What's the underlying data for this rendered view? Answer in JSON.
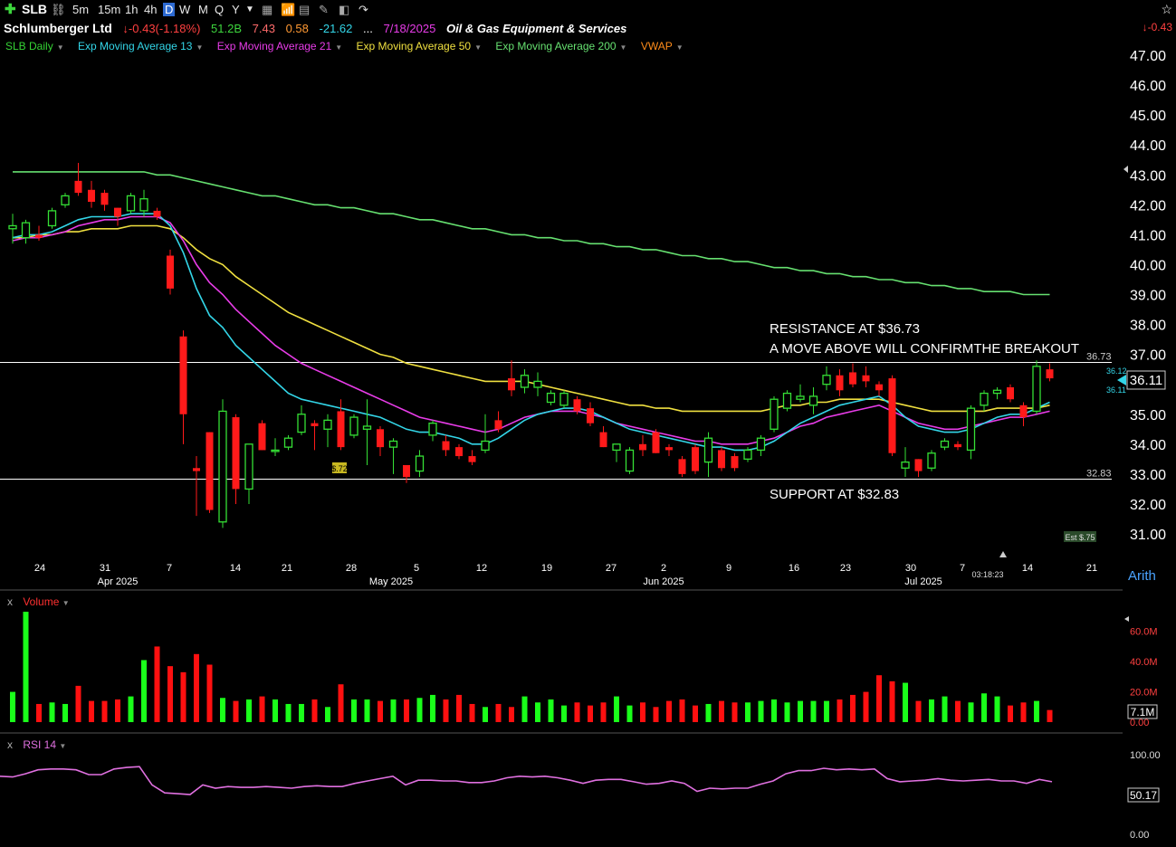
{
  "toolbar": {
    "symbol": "SLB",
    "intervals": [
      "5m",
      "15m",
      "1h",
      "4h",
      "D",
      "W",
      "M",
      "Q",
      "Y"
    ],
    "selected_interval": "D"
  },
  "header": {
    "company": "Schlumberger Ltd",
    "change": "-0.43(-1.18%)",
    "volume": "51.2B",
    "v1": "7.43",
    "v2": "0.58",
    "v3": "-21.62",
    "dots": "...",
    "date": "7/18/2025",
    "industry": "Oil & Gas Equipment & Services",
    "right_change": "-0.43"
  },
  "legend": [
    {
      "label": "SLB Daily",
      "color": "#35d435"
    },
    {
      "label": "Exp Moving Average 13",
      "color": "#33d6e8"
    },
    {
      "label": "Exp Moving Average 21",
      "color": "#e83ce8"
    },
    {
      "label": "Exp Moving Average 50",
      "color": "#f0e040"
    },
    {
      "label": "Exp Moving Average 200",
      "color": "#66e070"
    },
    {
      "label": "VWAP",
      "color": "#ff8c1a"
    }
  ],
  "annotations": {
    "resistance_line1": "RESISTANCE AT $36.73",
    "resistance_line2": "A MOVE ABOVE WILL CONFIRMTHE BREAKOUT",
    "support": "SUPPORT AT $32.83",
    "resistance_value": "36.73",
    "support_value": "32.83",
    "ema13_tag": "36.12",
    "ema_tag2": "36.11",
    "last_price": "36.11",
    "low_label": "$.72",
    "est_label": "Est $.75",
    "timer": "03:18:23",
    "scale_mode": "Arith"
  },
  "volume_pane": {
    "title": "Volume",
    "ticks": [
      "60.0M",
      "40.0M",
      "20.0M",
      "0.00"
    ],
    "last": "7.1M"
  },
  "rsi_pane": {
    "title": "RSI 14",
    "ticks": [
      "100.00",
      "0.00"
    ],
    "last": "50.17"
  },
  "chart_data": {
    "type": "candlestick",
    "y_axis": {
      "ticks": [
        "47.00",
        "46.00",
        "45.00",
        "44.00",
        "43.00",
        "42.00",
        "41.00",
        "40.00",
        "39.00",
        "38.00",
        "37.00",
        "36.00",
        "35.00",
        "34.00",
        "33.00",
        "32.00",
        "31.00"
      ],
      "range": [
        30.5,
        47.8
      ]
    },
    "x_axis": {
      "day_ticks": [
        "24",
        "31",
        "7",
        "14",
        "21",
        "28",
        "5",
        "12",
        "19",
        "27",
        "2",
        "9",
        "16",
        "23",
        "30",
        "7",
        "14",
        "21"
      ],
      "month_ticks": [
        "Apr 2025",
        "May 2025",
        "Jun 2025",
        "Jul 2025"
      ]
    },
    "candles": [
      {
        "o": 41.2,
        "h": 41.7,
        "l": 40.7,
        "c": 41.3
      },
      {
        "o": 40.9,
        "h": 41.5,
        "l": 40.7,
        "c": 41.4
      },
      {
        "o": 41.0,
        "h": 41.3,
        "l": 40.8,
        "c": 40.9
      },
      {
        "o": 41.3,
        "h": 41.9,
        "l": 41.2,
        "c": 41.8
      },
      {
        "o": 42.0,
        "h": 42.4,
        "l": 41.9,
        "c": 42.3
      },
      {
        "o": 42.8,
        "h": 43.4,
        "l": 42.3,
        "c": 42.4
      },
      {
        "o": 42.5,
        "h": 42.8,
        "l": 41.9,
        "c": 42.1
      },
      {
        "o": 42.4,
        "h": 42.5,
        "l": 41.8,
        "c": 42.0
      },
      {
        "o": 41.9,
        "h": 41.9,
        "l": 41.3,
        "c": 41.6
      },
      {
        "o": 41.8,
        "h": 42.4,
        "l": 41.7,
        "c": 42.3
      },
      {
        "o": 41.8,
        "h": 42.5,
        "l": 41.6,
        "c": 42.2
      },
      {
        "o": 41.8,
        "h": 41.9,
        "l": 41.5,
        "c": 41.6
      },
      {
        "o": 40.3,
        "h": 40.5,
        "l": 39.0,
        "c": 39.2
      },
      {
        "o": 37.6,
        "h": 37.8,
        "l": 34.0,
        "c": 35.0
      },
      {
        "o": 33.2,
        "h": 33.6,
        "l": 31.6,
        "c": 33.1
      },
      {
        "o": 34.4,
        "h": 34.4,
        "l": 31.7,
        "c": 31.8
      },
      {
        "o": 31.4,
        "h": 35.5,
        "l": 31.2,
        "c": 35.1
      },
      {
        "o": 34.9,
        "h": 35.0,
        "l": 32.0,
        "c": 32.5
      },
      {
        "o": 32.5,
        "h": 34.0,
        "l": 32.0,
        "c": 34.0
      },
      {
        "o": 34.7,
        "h": 34.8,
        "l": 33.8,
        "c": 33.8
      },
      {
        "o": 33.8,
        "h": 34.2,
        "l": 33.6,
        "c": 33.8
      },
      {
        "o": 33.9,
        "h": 34.3,
        "l": 33.8,
        "c": 34.2
      },
      {
        "o": 34.4,
        "h": 35.3,
        "l": 34.3,
        "c": 35.0
      },
      {
        "o": 34.7,
        "h": 34.8,
        "l": 33.8,
        "c": 34.6
      },
      {
        "o": 34.5,
        "h": 35.0,
        "l": 33.9,
        "c": 34.8
      },
      {
        "o": 35.1,
        "h": 35.5,
        "l": 33.8,
        "c": 33.9
      },
      {
        "o": 34.3,
        "h": 35.0,
        "l": 34.2,
        "c": 34.9
      },
      {
        "o": 34.5,
        "h": 35.5,
        "l": 33.3,
        "c": 34.6
      },
      {
        "o": 34.5,
        "h": 34.6,
        "l": 33.6,
        "c": 33.9
      },
      {
        "o": 33.9,
        "h": 34.2,
        "l": 33.0,
        "c": 34.1
      },
      {
        "o": 33.3,
        "h": 33.3,
        "l": 32.7,
        "c": 32.9
      },
      {
        "o": 33.1,
        "h": 33.8,
        "l": 32.9,
        "c": 33.6
      },
      {
        "o": 34.3,
        "h": 34.8,
        "l": 34.1,
        "c": 34.7
      },
      {
        "o": 34.1,
        "h": 34.3,
        "l": 33.6,
        "c": 33.8
      },
      {
        "o": 33.9,
        "h": 34.0,
        "l": 33.5,
        "c": 33.6
      },
      {
        "o": 33.6,
        "h": 33.8,
        "l": 33.3,
        "c": 33.4
      },
      {
        "o": 33.8,
        "h": 35.0,
        "l": 33.7,
        "c": 34.1
      },
      {
        "o": 34.8,
        "h": 35.1,
        "l": 34.4,
        "c": 34.5
      },
      {
        "o": 36.2,
        "h": 36.8,
        "l": 35.6,
        "c": 35.8
      },
      {
        "o": 35.9,
        "h": 36.5,
        "l": 35.7,
        "c": 36.3
      },
      {
        "o": 35.9,
        "h": 36.4,
        "l": 35.6,
        "c": 36.1
      },
      {
        "o": 35.4,
        "h": 35.8,
        "l": 35.3,
        "c": 35.7
      },
      {
        "o": 35.3,
        "h": 35.8,
        "l": 35.2,
        "c": 35.7
      },
      {
        "o": 35.5,
        "h": 35.6,
        "l": 35.0,
        "c": 35.1
      },
      {
        "o": 35.2,
        "h": 35.4,
        "l": 34.6,
        "c": 34.7
      },
      {
        "o": 34.4,
        "h": 34.6,
        "l": 33.9,
        "c": 33.9
      },
      {
        "o": 33.8,
        "h": 34.0,
        "l": 33.4,
        "c": 34.0
      },
      {
        "o": 33.1,
        "h": 33.9,
        "l": 33.0,
        "c": 33.8
      },
      {
        "o": 34.0,
        "h": 34.3,
        "l": 33.6,
        "c": 33.8
      },
      {
        "o": 34.4,
        "h": 34.5,
        "l": 33.7,
        "c": 33.7
      },
      {
        "o": 33.9,
        "h": 34.0,
        "l": 33.6,
        "c": 33.8
      },
      {
        "o": 33.5,
        "h": 33.6,
        "l": 32.9,
        "c": 33.0
      },
      {
        "o": 33.9,
        "h": 34.0,
        "l": 33.0,
        "c": 33.1
      },
      {
        "o": 33.4,
        "h": 34.4,
        "l": 32.9,
        "c": 34.2
      },
      {
        "o": 33.8,
        "h": 33.9,
        "l": 33.1,
        "c": 33.2
      },
      {
        "o": 33.6,
        "h": 33.7,
        "l": 33.1,
        "c": 33.2
      },
      {
        "o": 33.5,
        "h": 33.9,
        "l": 33.4,
        "c": 33.8
      },
      {
        "o": 33.8,
        "h": 34.3,
        "l": 33.6,
        "c": 34.2
      },
      {
        "o": 34.5,
        "h": 35.6,
        "l": 34.4,
        "c": 35.5
      },
      {
        "o": 35.2,
        "h": 35.8,
        "l": 35.1,
        "c": 35.7
      },
      {
        "o": 35.5,
        "h": 36.0,
        "l": 35.4,
        "c": 35.6
      },
      {
        "o": 35.3,
        "h": 35.9,
        "l": 35.0,
        "c": 35.6
      },
      {
        "o": 36.0,
        "h": 36.6,
        "l": 35.8,
        "c": 36.3
      },
      {
        "o": 36.3,
        "h": 36.5,
        "l": 35.6,
        "c": 35.8
      },
      {
        "o": 36.4,
        "h": 36.7,
        "l": 35.9,
        "c": 36.0
      },
      {
        "o": 36.3,
        "h": 36.6,
        "l": 35.9,
        "c": 36.1
      },
      {
        "o": 36.0,
        "h": 36.1,
        "l": 35.6,
        "c": 35.8
      },
      {
        "o": 36.2,
        "h": 36.3,
        "l": 33.6,
        "c": 33.7
      },
      {
        "o": 33.2,
        "h": 33.9,
        "l": 32.9,
        "c": 33.4
      },
      {
        "o": 33.5,
        "h": 33.5,
        "l": 32.9,
        "c": 33.1
      },
      {
        "o": 33.2,
        "h": 33.8,
        "l": 33.1,
        "c": 33.7
      },
      {
        "o": 33.9,
        "h": 34.2,
        "l": 33.8,
        "c": 34.1
      },
      {
        "o": 34.0,
        "h": 34.1,
        "l": 33.8,
        "c": 33.9
      },
      {
        "o": 33.8,
        "h": 35.3,
        "l": 33.5,
        "c": 35.2
      },
      {
        "o": 35.3,
        "h": 35.8,
        "l": 35.1,
        "c": 35.7
      },
      {
        "o": 35.7,
        "h": 35.9,
        "l": 35.5,
        "c": 35.8
      },
      {
        "o": 35.9,
        "h": 36.0,
        "l": 35.4,
        "c": 35.5
      },
      {
        "o": 35.3,
        "h": 35.4,
        "l": 34.6,
        "c": 34.9
      },
      {
        "o": 35.1,
        "h": 36.8,
        "l": 35.0,
        "c": 36.6
      },
      {
        "o": 36.5,
        "h": 36.7,
        "l": 36.1,
        "c": 36.2
      }
    ],
    "ema13": [
      40.9,
      41.0,
      41.0,
      41.1,
      41.3,
      41.5,
      41.6,
      41.6,
      41.6,
      41.7,
      41.7,
      41.7,
      41.3,
      40.4,
      39.2,
      38.3,
      37.9,
      37.3,
      36.9,
      36.5,
      36.1,
      35.7,
      35.5,
      35.4,
      35.3,
      35.2,
      35.1,
      35.0,
      34.9,
      34.7,
      34.5,
      34.4,
      34.4,
      34.3,
      34.2,
      34.0,
      34.0,
      34.2,
      34.5,
      34.8,
      35.0,
      35.1,
      35.2,
      35.2,
      35.1,
      34.9,
      34.7,
      34.5,
      34.4,
      34.3,
      34.2,
      34.1,
      34.0,
      33.9,
      33.9,
      33.8,
      33.8,
      33.9,
      34.1,
      34.4,
      34.7,
      34.9,
      35.1,
      35.3,
      35.4,
      35.5,
      35.6,
      35.3,
      34.9,
      34.6,
      34.5,
      34.4,
      34.4,
      34.5,
      34.7,
      34.9,
      35.0,
      35.0,
      35.2,
      35.4
    ],
    "ema21": [
      40.8,
      40.9,
      40.9,
      41.0,
      41.1,
      41.3,
      41.4,
      41.5,
      41.5,
      41.6,
      41.6,
      41.6,
      41.4,
      40.8,
      40.0,
      39.4,
      39.0,
      38.5,
      38.1,
      37.7,
      37.3,
      37.0,
      36.7,
      36.5,
      36.3,
      36.1,
      35.9,
      35.7,
      35.5,
      35.3,
      35.1,
      34.9,
      34.8,
      34.7,
      34.6,
      34.5,
      34.4,
      34.5,
      34.7,
      34.9,
      35.0,
      35.1,
      35.1,
      35.1,
      35.0,
      34.9,
      34.7,
      34.6,
      34.5,
      34.4,
      34.3,
      34.2,
      34.1,
      34.1,
      34.0,
      34.0,
      34.0,
      34.1,
      34.2,
      34.4,
      34.6,
      34.7,
      34.9,
      35.0,
      35.1,
      35.2,
      35.3,
      35.1,
      34.9,
      34.7,
      34.6,
      34.5,
      34.5,
      34.6,
      34.7,
      34.8,
      34.9,
      34.9,
      35.0,
      35.1
    ],
    "ema50": [
      40.9,
      40.9,
      41.0,
      41.0,
      41.1,
      41.1,
      41.2,
      41.2,
      41.2,
      41.3,
      41.3,
      41.3,
      41.2,
      40.9,
      40.5,
      40.2,
      40.0,
      39.6,
      39.3,
      39.0,
      38.7,
      38.4,
      38.2,
      38.0,
      37.8,
      37.6,
      37.4,
      37.2,
      37.0,
      36.9,
      36.7,
      36.6,
      36.5,
      36.4,
      36.3,
      36.2,
      36.1,
      36.1,
      36.1,
      36.1,
      36.0,
      35.9,
      35.8,
      35.7,
      35.6,
      35.5,
      35.4,
      35.3,
      35.3,
      35.2,
      35.2,
      35.1,
      35.1,
      35.1,
      35.1,
      35.1,
      35.1,
      35.1,
      35.2,
      35.3,
      35.3,
      35.4,
      35.4,
      35.5,
      35.5,
      35.5,
      35.5,
      35.4,
      35.3,
      35.2,
      35.1,
      35.1,
      35.1,
      35.1,
      35.1,
      35.2,
      35.2,
      35.2,
      35.2,
      35.3
    ],
    "ema200": [
      43.1,
      43.1,
      43.1,
      43.1,
      43.1,
      43.1,
      43.1,
      43.1,
      43.1,
      43.1,
      43.1,
      43.0,
      43.0,
      42.9,
      42.8,
      42.7,
      42.6,
      42.5,
      42.4,
      42.3,
      42.3,
      42.2,
      42.1,
      42.0,
      42.0,
      41.9,
      41.9,
      41.8,
      41.7,
      41.7,
      41.6,
      41.5,
      41.5,
      41.4,
      41.3,
      41.2,
      41.2,
      41.1,
      41.0,
      41.0,
      40.9,
      40.9,
      40.8,
      40.8,
      40.7,
      40.7,
      40.6,
      40.6,
      40.5,
      40.5,
      40.4,
      40.3,
      40.3,
      40.2,
      40.2,
      40.1,
      40.1,
      40.0,
      39.9,
      39.9,
      39.8,
      39.8,
      39.7,
      39.7,
      39.6,
      39.6,
      39.5,
      39.5,
      39.4,
      39.4,
      39.3,
      39.3,
      39.2,
      39.2,
      39.1,
      39.1,
      39.1,
      39.0,
      39.0,
      39.0
    ],
    "volume_ylim": [
      0,
      73
    ],
    "volume_m": [
      20,
      73,
      12,
      13,
      12,
      24,
      14,
      14,
      15,
      17,
      41,
      50,
      37,
      33,
      45,
      38,
      16,
      14,
      15,
      17,
      15,
      12,
      12,
      15,
      10,
      25,
      15,
      15,
      14,
      15,
      15,
      16,
      18,
      15,
      18,
      12,
      10,
      12,
      10,
      17,
      13,
      15,
      11,
      13,
      11,
      13,
      17,
      11,
      13,
      10,
      14,
      15,
      11,
      12,
      14,
      13,
      13,
      14,
      15,
      13,
      14,
      14,
      14,
      15,
      18,
      20,
      31,
      27,
      26,
      14,
      15,
      17,
      14,
      13,
      19,
      17,
      11,
      13,
      14,
      8
    ],
    "rsi_ylim": [
      0,
      100
    ],
    "rsi": [
      73,
      72,
      76,
      81,
      82,
      82,
      81,
      75,
      75,
      82,
      84,
      85,
      62,
      52,
      51,
      50,
      62,
      58,
      60,
      59,
      59,
      60,
      59,
      58,
      60,
      61,
      60,
      60,
      64,
      67,
      70,
      73,
      62,
      68,
      68,
      67,
      67,
      65,
      65,
      67,
      71,
      73,
      72,
      73,
      71,
      68,
      64,
      68,
      69,
      69,
      66,
      63,
      64,
      67,
      64,
      54,
      58,
      57,
      58,
      58,
      63,
      67,
      76,
      80,
      80,
      83,
      81,
      82,
      81,
      82,
      70,
      66,
      67,
      68,
      70,
      68,
      67,
      68,
      69,
      67,
      67,
      64,
      69,
      66
    ]
  }
}
